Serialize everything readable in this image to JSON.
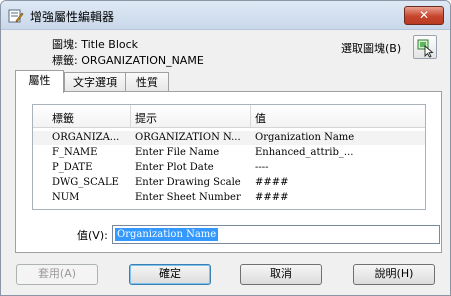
{
  "window": {
    "title": "增強屬性編輯器",
    "close_glyph": "✕"
  },
  "info": {
    "block_line": "圖塊: Title Block",
    "tag_line": "標籤: ORGANIZATION_NAME",
    "pick_label": "選取圖塊(B)"
  },
  "tabs": [
    {
      "label": "屬性",
      "active": true
    },
    {
      "label": "文字選項",
      "active": false
    },
    {
      "label": "性質",
      "active": false
    }
  ],
  "table": {
    "columns": [
      "標籤",
      "提示",
      "值"
    ],
    "rows": [
      {
        "tag": "ORGANIZA...",
        "prompt": "ORGANIZATION N...",
        "value": "Organization Name",
        "selected": true
      },
      {
        "tag": "F_NAME",
        "prompt": "Enter File Name",
        "value": "Enhanced_attrib_...",
        "selected": false
      },
      {
        "tag": "P_DATE",
        "prompt": "Enter Plot Date",
        "value": "----",
        "selected": false
      },
      {
        "tag": "DWG_SCALE",
        "prompt": "Enter Drawing Scale",
        "value": "####",
        "selected": false
      },
      {
        "tag": "NUM",
        "prompt": "Enter Sheet Number",
        "value": "####",
        "selected": false
      }
    ]
  },
  "value_field": {
    "label": "值(V):",
    "value": "Organization Name"
  },
  "buttons": {
    "apply": "套用(A)",
    "ok": "確定",
    "cancel": "取消",
    "help": "說明(H)"
  },
  "colors": {
    "selection": "#3399ff",
    "close_button": "#c7452d",
    "title_bar": "#c9d8ea"
  }
}
